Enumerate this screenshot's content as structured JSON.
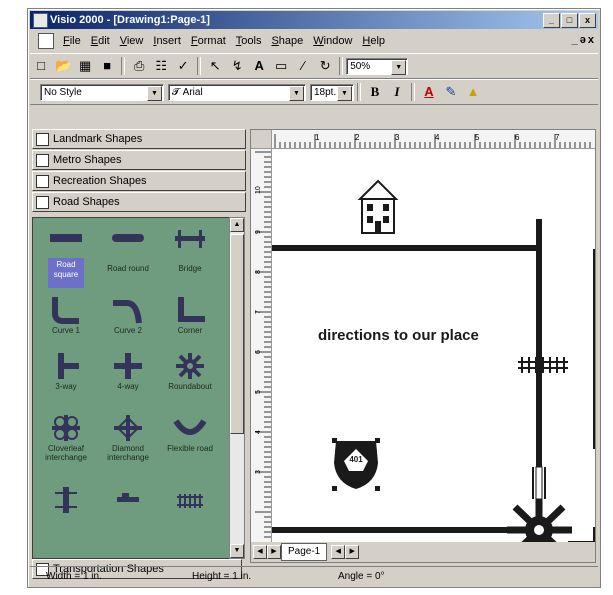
{
  "window": {
    "title": "Visio 2000 - [Drawing1:Page-1]",
    "controls": [
      "_",
      "□",
      "x"
    ],
    "doc_controls": [
      "_",
      "ə",
      "x"
    ]
  },
  "menu": {
    "items": [
      "File",
      "Edit",
      "View",
      "Insert",
      "Format",
      "Tools",
      "Shape",
      "Window",
      "Help"
    ]
  },
  "toolbar1": {
    "zoom_value": "50%"
  },
  "toolbar2": {
    "style_value": "No Style",
    "font_value": "Arial",
    "size_value": "18pt.",
    "bold_label": "B",
    "italic_label": "I"
  },
  "stencils": {
    "tabs": [
      "Landmark Shapes",
      "Metro Shapes",
      "Recreation Shapes",
      "Road Shapes"
    ],
    "bottom_tab": "Transportation Shapes",
    "shapes": [
      {
        "label": "Road square",
        "icon": "road-square-icon"
      },
      {
        "label": "Road round",
        "icon": "road-round-icon"
      },
      {
        "label": "Bridge",
        "icon": "bridge-icon"
      },
      {
        "label": "Curve 1",
        "icon": "curve-1-icon"
      },
      {
        "label": "Curve 2",
        "icon": "curve-2-icon"
      },
      {
        "label": "Corner",
        "icon": "corner-icon"
      },
      {
        "label": "3-way",
        "icon": "three-way-icon"
      },
      {
        "label": "4-way",
        "icon": "four-way-icon"
      },
      {
        "label": "Roundabout",
        "icon": "roundabout-icon"
      },
      {
        "label": "Cloverleaf interchange",
        "icon": "cloverleaf-icon"
      },
      {
        "label": "Diamond interchange",
        "icon": "diamond-interchange-icon"
      },
      {
        "label": "Flexible road",
        "icon": "flexible-road-icon"
      },
      {
        "label": "",
        "icon": "railroad-crossing-icon"
      },
      {
        "label": "",
        "icon": "road-sign-icon"
      },
      {
        "label": "",
        "icon": "railroad-icon"
      }
    ]
  },
  "drawing": {
    "ruler_marks": [
      "1",
      "2",
      "3",
      "4",
      "5",
      "6",
      "7"
    ],
    "vruler_marks": [
      "10",
      "9",
      "8",
      "7",
      "6",
      "5",
      "4",
      "3"
    ],
    "text": "directions to our place",
    "highway_sign": "401",
    "page_tab": "Page-1"
  },
  "status": {
    "width": "Width = 1 in.",
    "height": "Height = 1 in.",
    "angle": "Angle = 0°"
  },
  "colors": {
    "stencil_bg": "#6f9c7e",
    "title_start": "#0a246a",
    "title_end": "#a6caf0",
    "road": "#1a1a1a"
  }
}
